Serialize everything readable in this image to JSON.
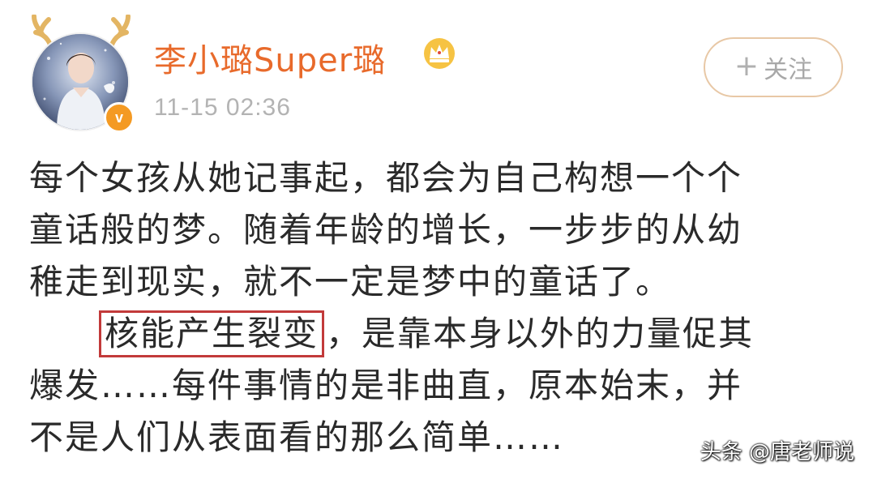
{
  "post": {
    "username": "李小璐Super璐",
    "timestamp": "11-15 02:36",
    "follow_label": "关注",
    "follow_plus": "+",
    "verified_mark": "v",
    "lines": [
      "每个女孩从她记事起，都会为自己构想一个个",
      "童话般的梦。随着年龄的增长，一步步的从幼",
      "稚走到现实，就不一定是梦中的童话了。"
    ],
    "highlight": "核能产生裂变",
    "line4_rest": "，是靠本身以外的力量促其",
    "lines_after": [
      "爆发……每件事情的是非曲直，原本始末，并",
      "不是人们从表面看的那么简单……"
    ]
  },
  "watermark": {
    "text": "头条 @唐老师说"
  },
  "icons": {
    "avatar": "avatar-photo",
    "crown": "crown-icon",
    "antlers": "antler-icon",
    "verified": "verified-badge-icon",
    "plus": "plus-icon"
  },
  "colors": {
    "username": "#e86a2b",
    "timestamp": "#b3b3b3",
    "follow_border": "#e8c8a6",
    "verified": "#f49a23",
    "highlight_border": "#c23a3a",
    "body_text": "#2a2a2a"
  }
}
